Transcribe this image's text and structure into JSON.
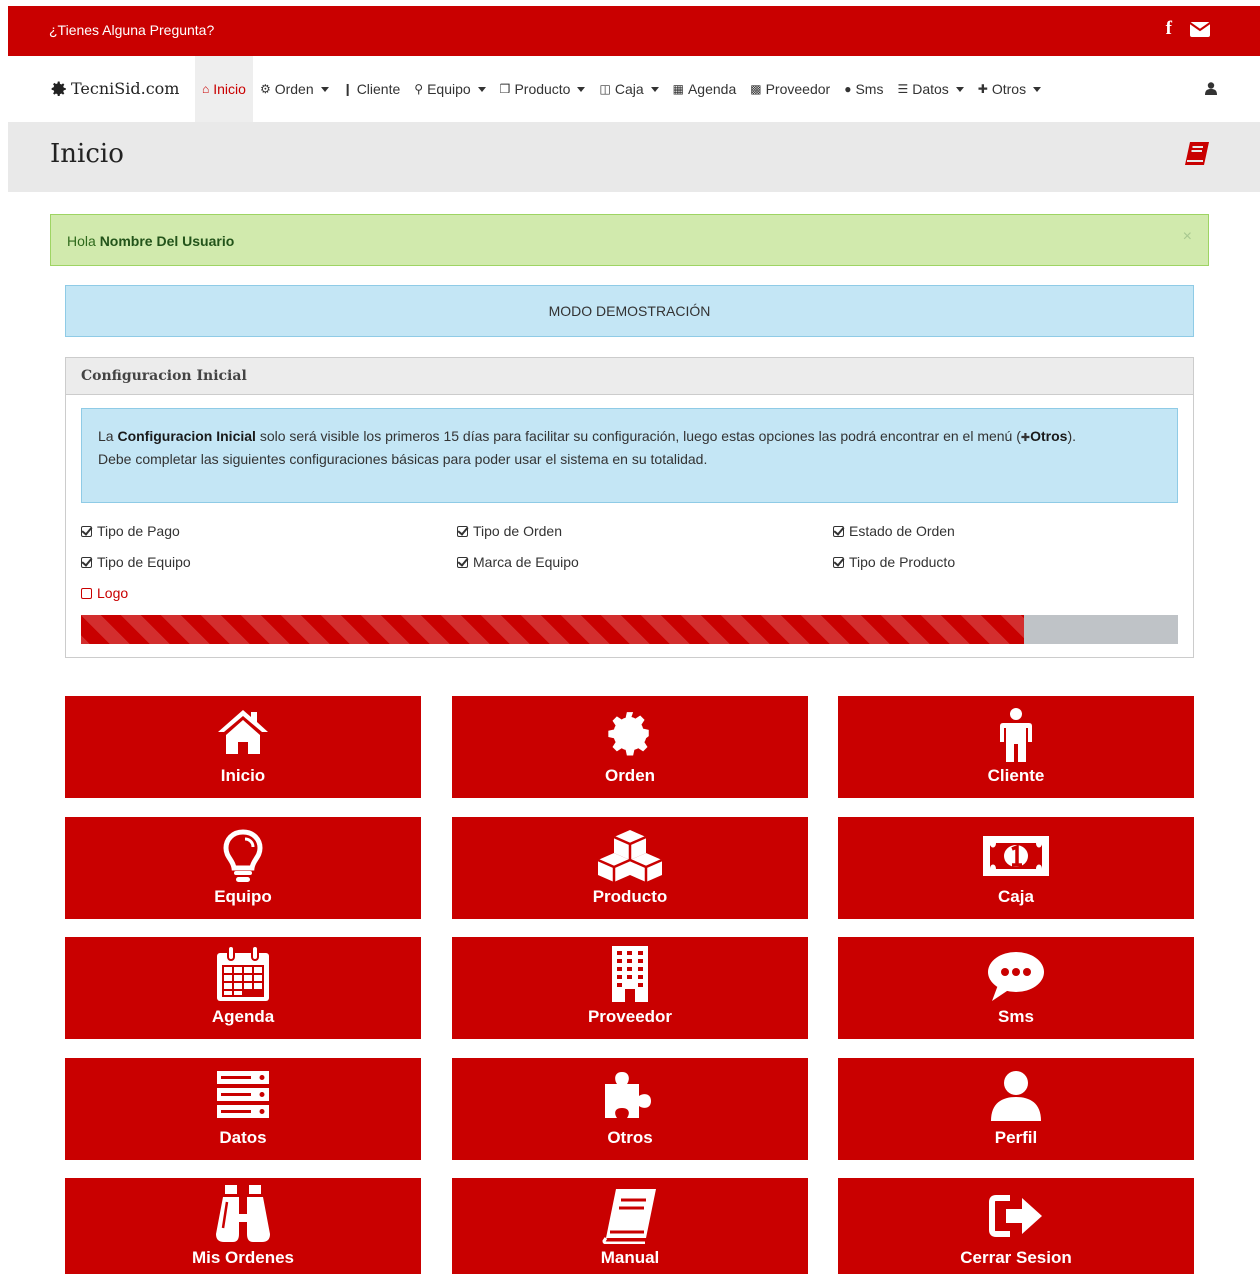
{
  "topbar": {
    "question": "¿Tienes Alguna Pregunta?",
    "social_icons": [
      "facebook-icon",
      "envelope-icon"
    ]
  },
  "navbar": {
    "brand": "TecniSid.com",
    "items": [
      {
        "label": "Inicio",
        "icon": "home-icon",
        "dropdown": false,
        "active": true
      },
      {
        "label": "Orden",
        "icon": "gear-icon",
        "dropdown": true
      },
      {
        "label": "Cliente",
        "icon": "person-icon",
        "dropdown": false
      },
      {
        "label": "Equipo",
        "icon": "lightbulb-icon",
        "dropdown": true
      },
      {
        "label": "Producto",
        "icon": "cubes-icon",
        "dropdown": true
      },
      {
        "label": "Caja",
        "icon": "money-icon",
        "dropdown": true
      },
      {
        "label": "Agenda",
        "icon": "calendar-icon",
        "dropdown": false
      },
      {
        "label": "Proveedor",
        "icon": "building-icon",
        "dropdown": false
      },
      {
        "label": "Sms",
        "icon": "comment-icon",
        "dropdown": false
      },
      {
        "label": "Datos",
        "icon": "server-icon",
        "dropdown": true
      },
      {
        "label": "Otros",
        "icon": "puzzle-icon",
        "dropdown": true
      }
    ]
  },
  "page_header": {
    "title": "Inicio"
  },
  "alert": {
    "prefix": "Hola ",
    "user_name": "Nombre Del Usuario",
    "close": "×"
  },
  "demo_banner": "MODO DEMOSTRACIÓN",
  "config_panel": {
    "title": "Configuracion Inicial",
    "info": {
      "part1": "La ",
      "strong1": "Configuracion Inicial",
      "part2": " solo será visible los primeros 15 días para facilitar su configuración, luego estas opciones las podrá encontrar en el menú (",
      "strong2": "Otros",
      "part3": ").",
      "line2": "Debe completar las siguientes configuraciones básicas para poder usar el sistema en su totalidad."
    },
    "checklist": [
      {
        "label": "Tipo de Pago",
        "done": true
      },
      {
        "label": "Tipo de Orden",
        "done": true
      },
      {
        "label": "Estado de Orden",
        "done": true
      },
      {
        "label": "Tipo de Equipo",
        "done": true
      },
      {
        "label": "Marca de Equipo",
        "done": true
      },
      {
        "label": "Tipo de Producto",
        "done": true
      },
      {
        "label": "Logo",
        "done": false
      }
    ],
    "progress_fraction": 0.86
  },
  "tiles": [
    {
      "label": "Inicio",
      "icon": "home-icon"
    },
    {
      "label": "Orden",
      "icon": "gear-icon"
    },
    {
      "label": "Cliente",
      "icon": "person-icon"
    },
    {
      "label": "Equipo",
      "icon": "lightbulb-icon"
    },
    {
      "label": "Producto",
      "icon": "cubes-icon"
    },
    {
      "label": "Caja",
      "icon": "money-icon"
    },
    {
      "label": "Agenda",
      "icon": "calendar-icon"
    },
    {
      "label": "Proveedor",
      "icon": "building-icon"
    },
    {
      "label": "Sms",
      "icon": "comment-icon"
    },
    {
      "label": "Datos",
      "icon": "server-icon"
    },
    {
      "label": "Otros",
      "icon": "puzzle-icon"
    },
    {
      "label": "Perfil",
      "icon": "user-icon"
    },
    {
      "label": "Mis Ordenes",
      "icon": "binoculars-icon"
    },
    {
      "label": "Manual",
      "icon": "book-icon"
    },
    {
      "label": "Cerrar Sesion",
      "icon": "sign-out-icon"
    }
  ],
  "colors": {
    "brand_red": "#c90000",
    "success_bg": "#d1eaad",
    "info_bg": "#c4e6f5",
    "header_bg": "#e9e9e9"
  }
}
